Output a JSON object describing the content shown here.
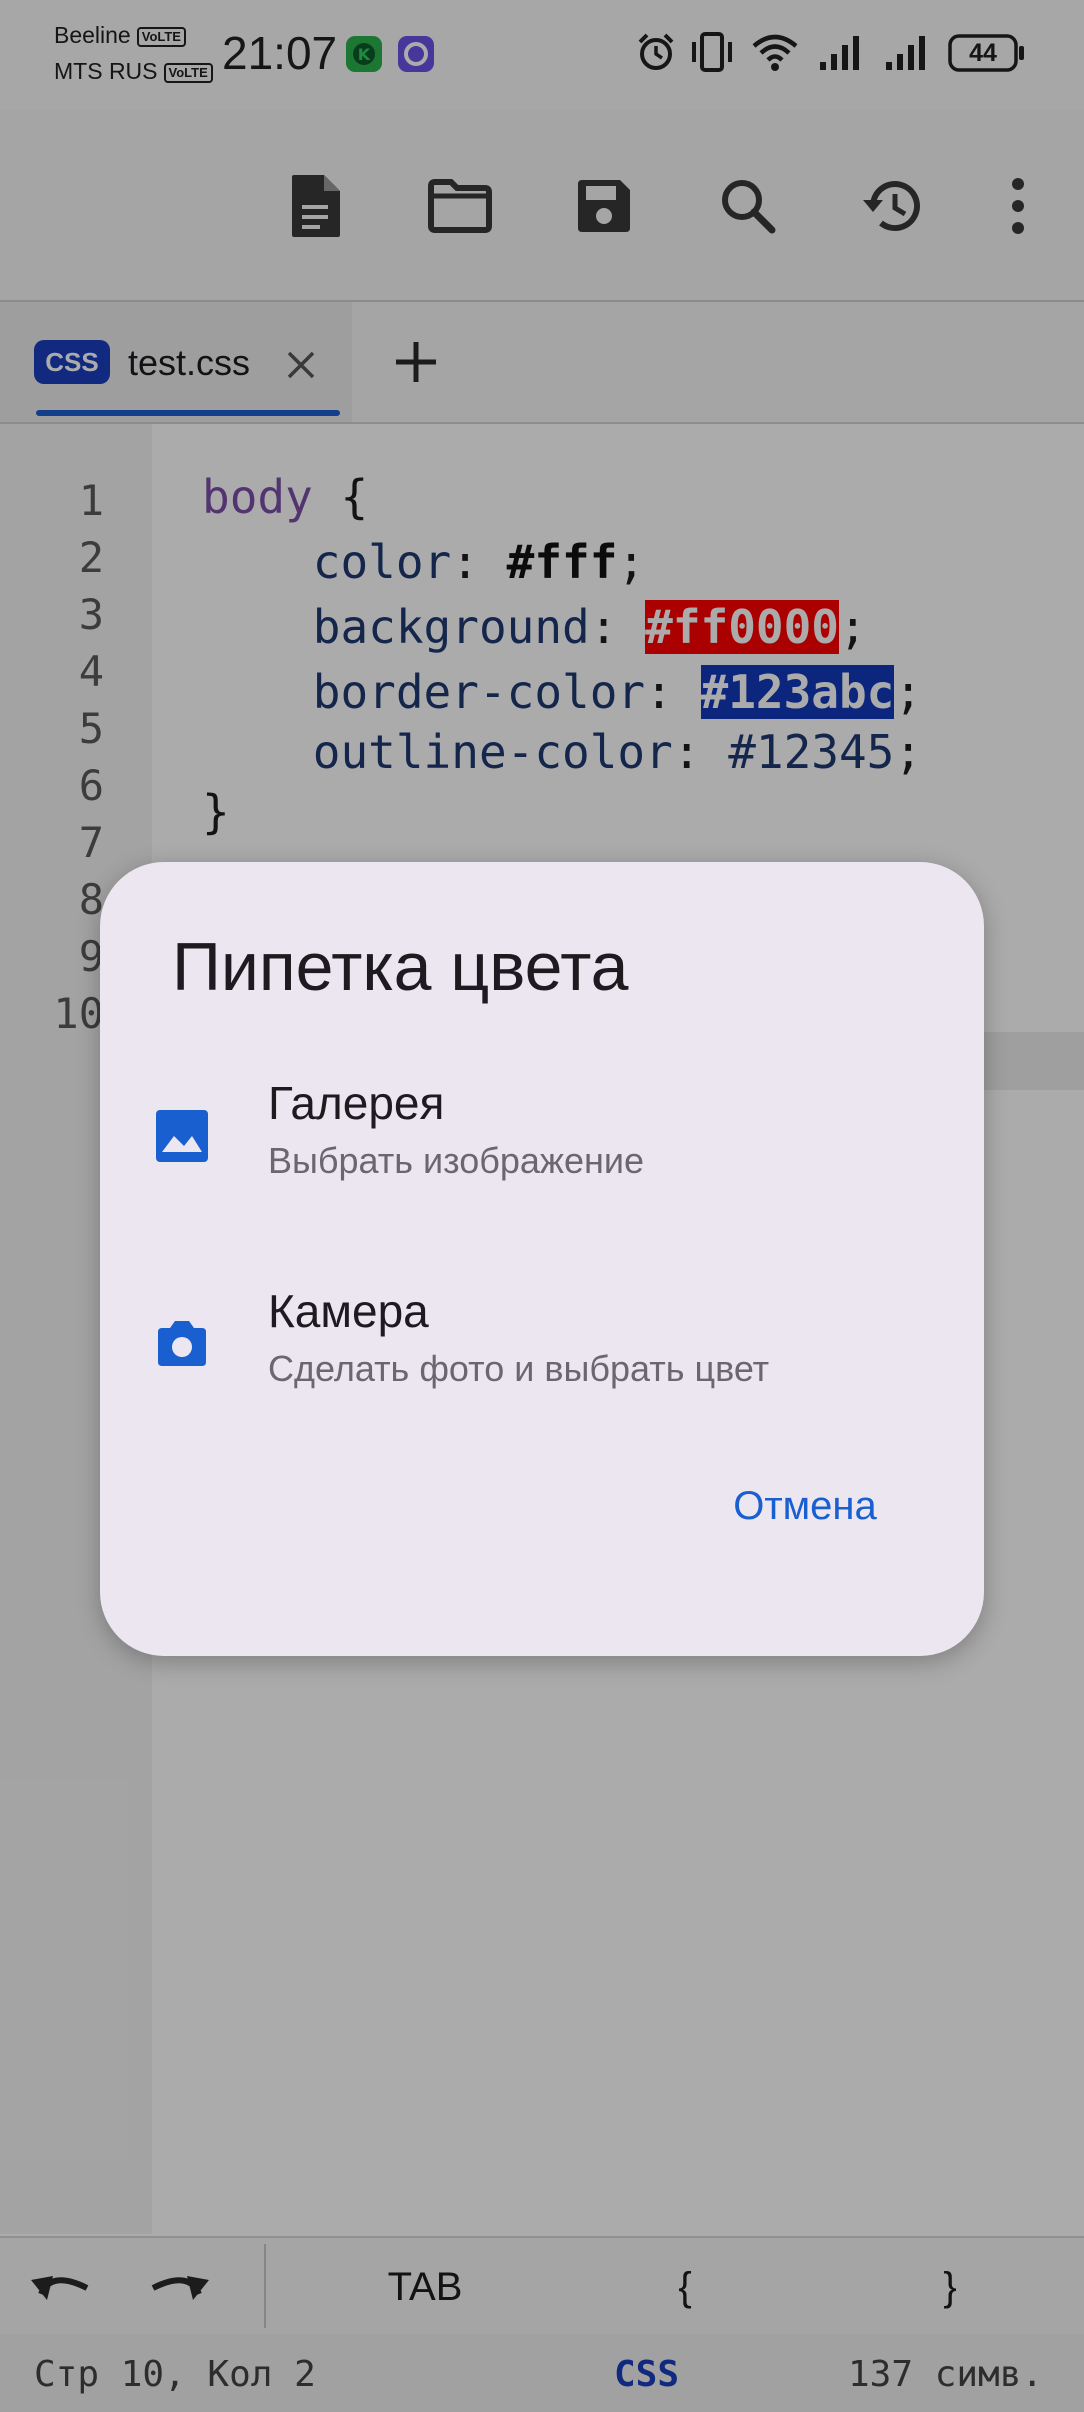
{
  "status_bar": {
    "carrier_1": "Beeline",
    "carrier_2": "MTS RUS",
    "volte": "VoLTE",
    "time": "21:07",
    "battery": "44"
  },
  "toolbar": {
    "icons": [
      "new-file-icon",
      "folder-icon",
      "save-icon",
      "search-icon",
      "history-icon",
      "more-vert-icon"
    ]
  },
  "tabs": {
    "badge": "CSS",
    "title": "test.css"
  },
  "editor": {
    "line_numbers": [
      "1",
      "2",
      "3",
      "4",
      "5",
      "6",
      "7",
      "8",
      "9",
      "10"
    ],
    "lines": {
      "l1_selector": "body",
      "l1_brace": " {",
      "l2_prop": "    color",
      "l2_colon": ": ",
      "l2_val": "#fff",
      "l2_semi": ";",
      "l3_prop": "    background",
      "l3_colon": ": ",
      "l3_val": "#ff0000",
      "l3_semi": ";",
      "l4_prop": "    border-color",
      "l4_colon": ": ",
      "l4_val": "#123abc",
      "l4_semi": ";",
      "l5_prop": "    outline-color",
      "l5_colon": ": ",
      "l5_val": "#12345",
      "l5_semi": ";",
      "l7_brace": "}"
    },
    "highlight_colors": {
      "red": "#ff0000",
      "blue": "#123abc"
    }
  },
  "keys": {
    "tab": "TAB",
    "open_brace": "{",
    "close_brace": "}"
  },
  "status_line": {
    "position": "Стр 10, Кол 2",
    "language": "CSS",
    "chars": "137 симв."
  },
  "dialog": {
    "title": "Пипетка цвета",
    "options": [
      {
        "icon": "image-icon",
        "title": "Галерея",
        "subtitle": "Выбрать изображение"
      },
      {
        "icon": "camera-icon",
        "title": "Камера",
        "subtitle": "Сделать фото и выбрать цвет"
      }
    ],
    "cancel": "Отмена"
  },
  "colors": {
    "accent": "#1a5fd0",
    "css_badge": "#1a3fbf",
    "dialog_bg": "#ece6f0"
  }
}
